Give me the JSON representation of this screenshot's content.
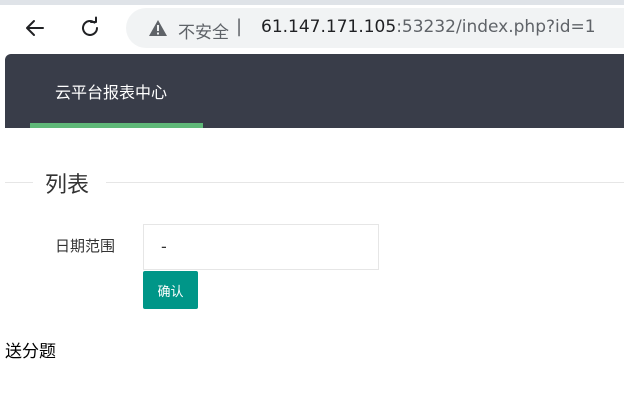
{
  "browser": {
    "security_label": "不安全",
    "divider": "|",
    "url_host": "61.147.171.105",
    "url_rest": ":53232/index.php?id=1"
  },
  "app": {
    "nav_item": "云平台报表中心",
    "legend": "列表",
    "date_range_label": "日期范围",
    "date_range_value": "-",
    "confirm_button": "确认",
    "footer_text": "送分题"
  },
  "colors": {
    "header_bg": "#393d49",
    "nav_active_underline": "#5fb878",
    "primary_button": "#009688"
  },
  "icons": [
    "back-arrow-icon",
    "reload-icon",
    "warning-icon"
  ]
}
